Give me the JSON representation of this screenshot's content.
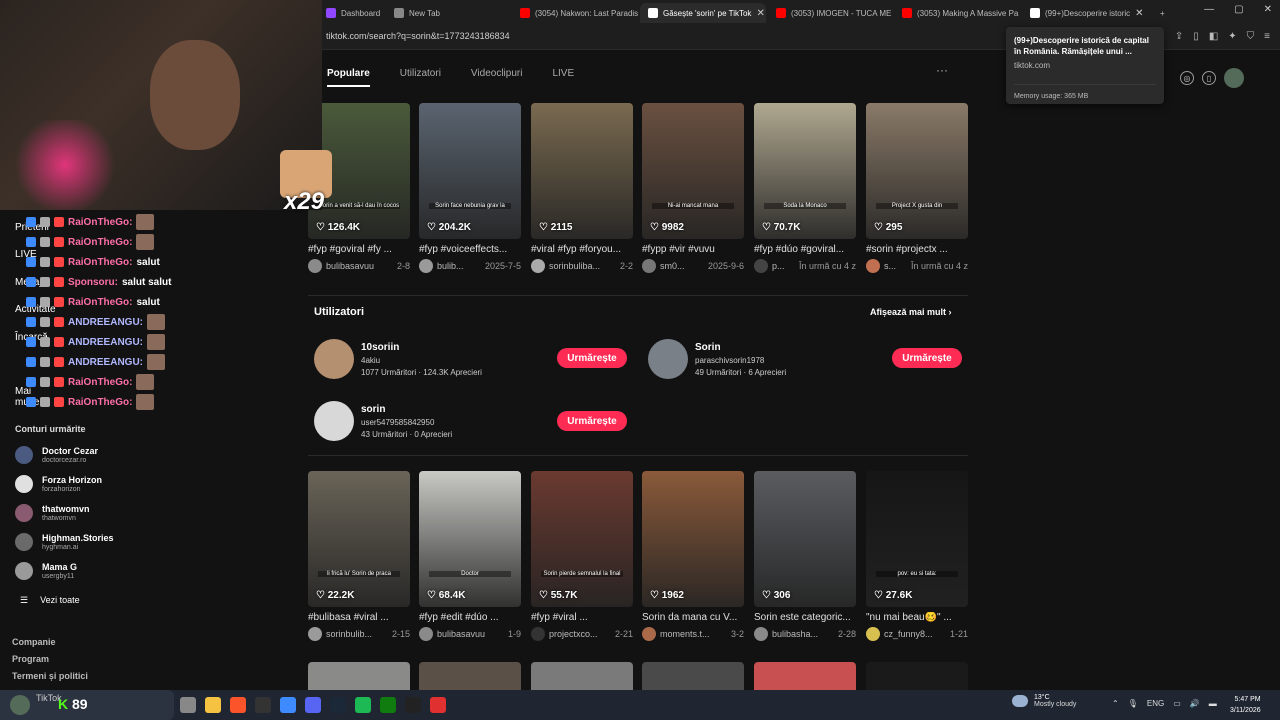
{
  "browser": {
    "tabs": [
      {
        "label": "Dashboard",
        "color": "#9147ff"
      },
      {
        "label": "New Tab",
        "color": "#888888"
      },
      {
        "label": "(3054) Nakwon: Last Paradise",
        "color": "#ff0000"
      },
      {
        "label": "Găsește 'sorin' pe TikTok",
        "color": "#ffffff"
      },
      {
        "label": "(3053) IMOGEN - TUCA ME A",
        "color": "#ff0000"
      },
      {
        "label": "(3053) Making A Massive Pa",
        "color": "#ff0000"
      },
      {
        "label": "(99+)Descoperire istoric",
        "color": "#ffffff"
      }
    ],
    "url": "tiktok.com/search?q=sorin&t=1773243186834",
    "window_controls": [
      "—",
      "▢",
      "✕"
    ],
    "tooltip": {
      "title": "(99+)Descoperire istorică de capital în România. Rămășițele unui ...",
      "domain": "tiktok.com",
      "memory": "Memory usage: 365 MB"
    }
  },
  "tiktok": {
    "tabs": [
      "Populare",
      "Utilizatori",
      "Videoclipuri",
      "LIVE"
    ],
    "more": "···",
    "top_videos": [
      {
        "likes": "126.4K",
        "caption": "Sorin a venit să-l dau în cocos",
        "desc": "#fyp #goviral #fy ...",
        "author": "bulibasavuu",
        "date": "2-8",
        "thumb": "#4a5a3a",
        "avatar": "#8a8a8a"
      },
      {
        "likes": "204.2K",
        "caption": "Sorin face nebunia grav la",
        "desc": "#fyp #voiceeffects...",
        "author": "bulib...",
        "date": "2025-7-5",
        "thumb": "#5a6470",
        "avatar": "#9a9a9a"
      },
      {
        "likes": "2115",
        "caption": "",
        "desc": "#viral #fyp #foryou...",
        "author": "sorinbuliba...",
        "date": "2-2",
        "thumb": "#7a6a50",
        "avatar": "#aaaaaa"
      },
      {
        "likes": "9982",
        "caption": "Ni-ai mancat mana",
        "desc": "#fypp #vir #vuvu",
        "author": "sm0...",
        "date": "2025-9-6",
        "thumb": "#6a5040",
        "avatar": "#777777"
      },
      {
        "likes": "70.7K",
        "caption": "Soda la Monaco",
        "desc": "#fyp #dúo #goviral...",
        "author": "p...",
        "date": "În urmă cu 4 z",
        "thumb": "#b0a890",
        "avatar": "#444444"
      },
      {
        "likes": "295",
        "caption": "Project X gusta din",
        "desc": "#sorin #projectx ...",
        "author": "s...",
        "date": "În urmă cu 4 z",
        "thumb": "#8a7a68",
        "avatar": "#c07050"
      }
    ],
    "users_section": {
      "title": "Utilizatori",
      "show_more": "Afișează mai mult",
      "follow_label": "Urmărește",
      "users": [
        {
          "name": "10soriin",
          "handle": "4akiu",
          "followers": "1077 Urmăritori",
          "likes": "124.3K Aprecieri",
          "avatar": "#b49070"
        },
        {
          "name": "Sorin",
          "handle": "paraschivsorin1978",
          "followers": "49 Urmăritori",
          "likes": "6 Aprecieri",
          "avatar": "#7a8088"
        },
        {
          "name": "sorin",
          "handle": "user5479585842950",
          "followers": "43 Urmăritori",
          "likes": "0 Aprecieri",
          "avatar": "#d8d8d8"
        }
      ]
    },
    "bottom_videos": [
      {
        "likes": "22.2K",
        "caption": "li frică lu' Sorin de praca",
        "desc": "#bulibasa #viral ...",
        "author": "sorinbulib...",
        "date": "2-15",
        "thumb": "#6a6458",
        "avatar": "#9a9a9a"
      },
      {
        "likes": "68.4K",
        "caption": "Doctor",
        "desc": "#fyp #edit #dúo ...",
        "author": "bulibasavuu",
        "date": "1-9",
        "thumb": "#c8c8c4",
        "avatar": "#8a8a8a"
      },
      {
        "likes": "55.7K",
        "caption": "Sorin pierde semnalul la final",
        "desc": "#fyp #viral ...",
        "author": "projectxco...",
        "date": "2-21",
        "thumb": "#6a3a30",
        "avatar": "#333333"
      },
      {
        "likes": "1962",
        "caption": "",
        "desc": "Sorin da mana cu V...",
        "author": "moments.t...",
        "date": "3-2",
        "thumb": "#8a5a3a",
        "avatar": "#aa6a4a"
      },
      {
        "likes": "306",
        "caption": "",
        "desc": "Sorin este categoric...",
        "author": "bulibasha...",
        "date": "2-28",
        "thumb": "#5a5c60",
        "avatar": "#8a8a8a"
      },
      {
        "likes": "27.6K",
        "caption": "pov: eu si tata:",
        "desc": "\"nu mai beau🥴\" ...",
        "author": "cz_funny8...",
        "date": "1-21",
        "thumb": "#161616",
        "avatar": "#d8c050"
      }
    ]
  },
  "sidebar": {
    "nav": [
      "Prieteni",
      "LIVE",
      "Mesaje",
      "Activitate",
      "Încarcă",
      "Mai multe"
    ],
    "followed_title": "Conturi urmărite",
    "followed": [
      {
        "name": "Doctor Cezar",
        "handle": "doctorcezar.ro",
        "color": "#4a5a80"
      },
      {
        "name": "Forza Horizon",
        "handle": "forzahorizon",
        "color": "#e0e0e0"
      },
      {
        "name": "thatwomvn",
        "handle": "thatwomvn",
        "color": "#8a5a70"
      },
      {
        "name": "Highman.Stories",
        "handle": "hyghman.ai",
        "color": "#6a6a6a"
      },
      {
        "name": "Mama G",
        "handle": "usergby11",
        "color": "#9a9a9a"
      }
    ],
    "view_all": "Vezi toate",
    "footer": [
      "Companie",
      "Program",
      "Termeni și politici"
    ]
  },
  "stream": {
    "combo": "x29",
    "chat": [
      {
        "user": "RaiOnTheGo:",
        "msg": "",
        "color": "#ff6fa8"
      },
      {
        "user": "RaiOnTheGo:",
        "msg": "",
        "color": "#ff6fa8"
      },
      {
        "user": "RaiOnTheGo:",
        "msg": "salut",
        "color": "#ff6fa8"
      },
      {
        "user": "Sponsoru:",
        "msg": "salut salut",
        "color": "#ff6fa8"
      },
      {
        "user": "RaiOnTheGo:",
        "msg": "salut",
        "color": "#ff6fa8"
      },
      {
        "user": "ANDREEANGU:",
        "msg": "",
        "color": "#b0b8ff"
      },
      {
        "user": "ANDREEANGU:",
        "msg": "",
        "color": "#b0b8ff"
      },
      {
        "user": "ANDREEANGU:",
        "msg": "",
        "color": "#b0b8ff"
      },
      {
        "user": "RaiOnTheGo:",
        "msg": "",
        "color": "#ff6fa8"
      },
      {
        "user": "RaiOnTheGo:",
        "msg": "",
        "color": "#ff6fa8"
      }
    ],
    "overlay_count": "89",
    "overlay_label": "TikTok"
  },
  "taskbar": {
    "apps": [
      "#888",
      "#f5c242",
      "#fb542b",
      "#333",
      "#3d8bff",
      "#5865f2",
      "#1b2838",
      "#1db954",
      "#107c10",
      "#222",
      "#e03030"
    ],
    "weather_temp": "13°C",
    "weather_desc": "Mostly cloudy",
    "lang": "ENG",
    "time": "5:47 PM",
    "date": "3/11/2026"
  }
}
